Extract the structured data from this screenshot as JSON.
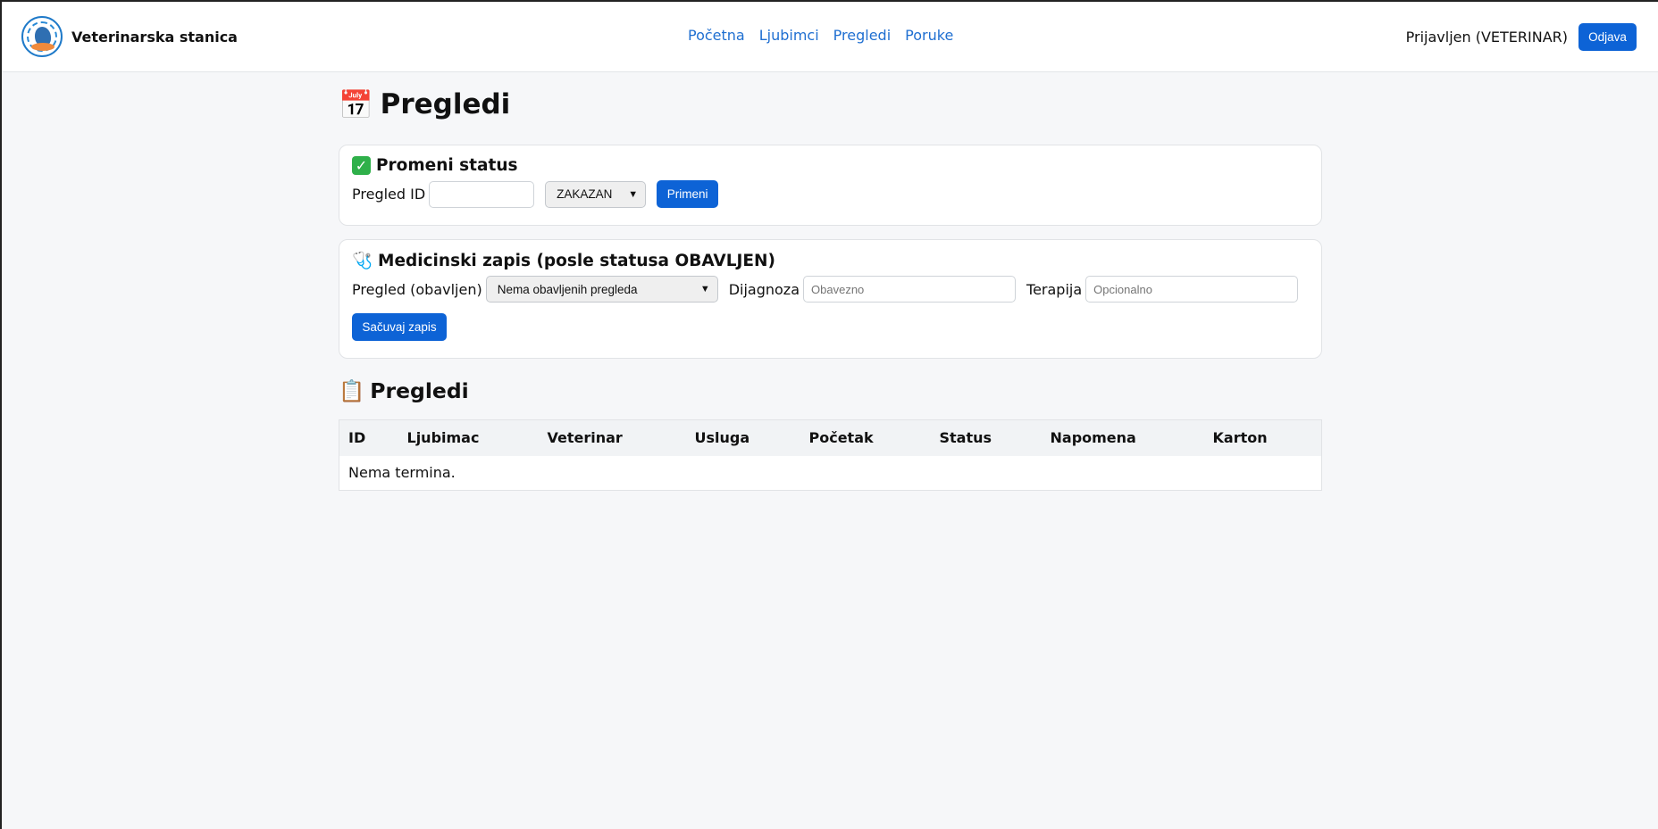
{
  "header": {
    "brand_name": "Veterinarska stanica",
    "logo_text": "VETERINARSKA STANICA · VAŠ LJUBIMAC",
    "nav": [
      "Početna",
      "Ljubimci",
      "Pregledi",
      "Poruke"
    ],
    "user_status": "Prijavljen (VETERINAR)",
    "logout_label": "Odjava"
  },
  "page": {
    "title_icon": "📅",
    "title": "Pregledi"
  },
  "status_card": {
    "icon": "✓",
    "title": "Promeni status",
    "id_label": "Pregled ID",
    "id_value": "",
    "status_selected": "ZAKAZAN",
    "apply_label": "Primeni"
  },
  "record_card": {
    "icon": "🩺",
    "title": "Medicinski zapis (posle statusa OBAVLJEN)",
    "exam_label": "Pregled (obavljen)",
    "exam_selected": "Nema obavljenih pregleda",
    "diagnosis_label": "Dijagnoza",
    "diagnosis_placeholder": "Obavezno",
    "therapy_label": "Terapija",
    "therapy_placeholder": "Opcionalno",
    "save_label": "Sačuvaj zapis"
  },
  "list": {
    "icon": "📋",
    "title": "Pregledi",
    "columns": [
      "ID",
      "Ljubimac",
      "Veterinar",
      "Usluga",
      "Početak",
      "Status",
      "Napomena",
      "Karton"
    ],
    "empty_text": "Nema termina."
  },
  "colors": {
    "accent": "#0d63d6",
    "link": "#1f6fd1",
    "background": "#f6f7f9"
  }
}
